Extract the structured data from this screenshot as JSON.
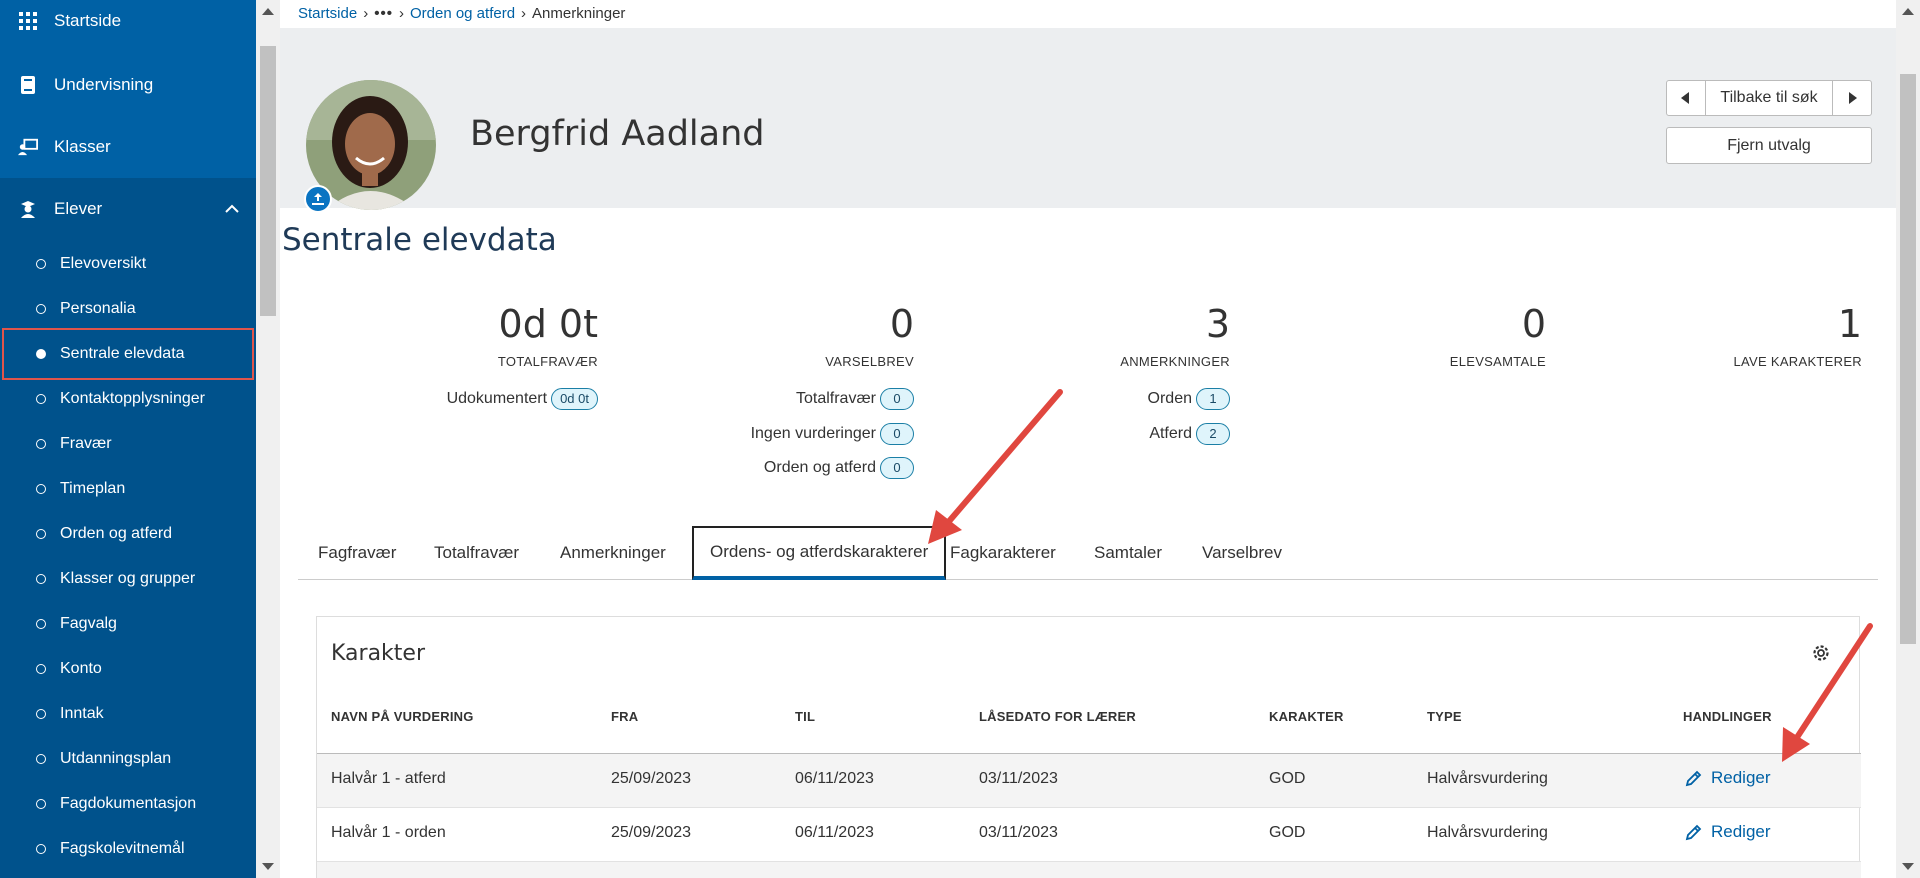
{
  "sidebar": {
    "main_items": [
      {
        "label": "Startside",
        "icon": "grid-icon"
      },
      {
        "label": "Undervisning",
        "icon": "book-icon"
      },
      {
        "label": "Klasser",
        "icon": "classroom-icon"
      },
      {
        "label": "Elever",
        "icon": "student-icon"
      }
    ],
    "sub_items": [
      {
        "label": "Elevoversikt"
      },
      {
        "label": "Personalia"
      },
      {
        "label": "Sentrale elevdata"
      },
      {
        "label": "Kontaktopplysninger"
      },
      {
        "label": "Fravær"
      },
      {
        "label": "Timeplan"
      },
      {
        "label": "Orden og atferd"
      },
      {
        "label": "Klasser og grupper"
      },
      {
        "label": "Fagvalg"
      },
      {
        "label": "Konto"
      },
      {
        "label": "Inntak"
      },
      {
        "label": "Utdanningsplan"
      },
      {
        "label": "Fagdokumentasjon"
      },
      {
        "label": "Fagskolevitnemål"
      }
    ],
    "accent_color": "#0061a5",
    "highlight_color": "#e0554b"
  },
  "breadcrumb": {
    "home": "Startside",
    "ellipsis": "•••",
    "parent": "Orden og atferd",
    "current": "Anmerkninger"
  },
  "student": {
    "name": "Bergfrid Aadland"
  },
  "header_buttons": {
    "back_to_search": "Tilbake til søk",
    "remove_selection": "Fjern utvalg"
  },
  "section": {
    "title": "Sentrale elevdata"
  },
  "stats": {
    "totalfravaer": {
      "value": "0d 0t",
      "label": "TOTALFRAVÆR",
      "rows": [
        {
          "label": "Udokumentert",
          "badge": "0d 0t"
        }
      ]
    },
    "varselbrev": {
      "value": "0",
      "label": "VARSELBREV",
      "rows": [
        {
          "label": "Totalfravær",
          "badge": "0"
        },
        {
          "label": "Ingen vurderinger",
          "badge": "0"
        },
        {
          "label": "Orden og atferd",
          "badge": "0"
        }
      ]
    },
    "anmerkninger": {
      "value": "3",
      "label": "ANMERKNINGER",
      "rows": [
        {
          "label": "Orden",
          "badge": "1"
        },
        {
          "label": "Atferd",
          "badge": "2"
        }
      ]
    },
    "elevsamtale": {
      "value": "0",
      "label": "ELEVSAMTALE"
    },
    "lave_karakterer": {
      "value": "1",
      "label": "LAVE KARAKTERER"
    }
  },
  "tabs": [
    {
      "label": "Fagfravær"
    },
    {
      "label": "Totalfravær"
    },
    {
      "label": "Anmerkninger"
    },
    {
      "label": "Ordens- og atferdskarakterer",
      "active": true
    },
    {
      "label": "Fagkarakterer"
    },
    {
      "label": "Samtaler"
    },
    {
      "label": "Varselbrev"
    }
  ],
  "grades_card": {
    "title": "Karakter",
    "columns": [
      "NAVN PÅ VURDERING",
      "FRA",
      "TIL",
      "LÅSEDATO FOR LÆRER",
      "KARAKTER",
      "TYPE",
      "HANDLINGER"
    ],
    "rows": [
      {
        "name": "Halvår 1 - atferd",
        "from": "25/09/2023",
        "to": "06/11/2023",
        "lock_date": "03/11/2023",
        "grade": "GOD",
        "type": "Halvårsvurdering",
        "action": "Rediger"
      },
      {
        "name": "Halvår 1 - orden",
        "from": "25/09/2023",
        "to": "06/11/2023",
        "lock_date": "03/11/2023",
        "grade": "GOD",
        "type": "Halvårsvurdering",
        "action": "Rediger"
      }
    ]
  }
}
